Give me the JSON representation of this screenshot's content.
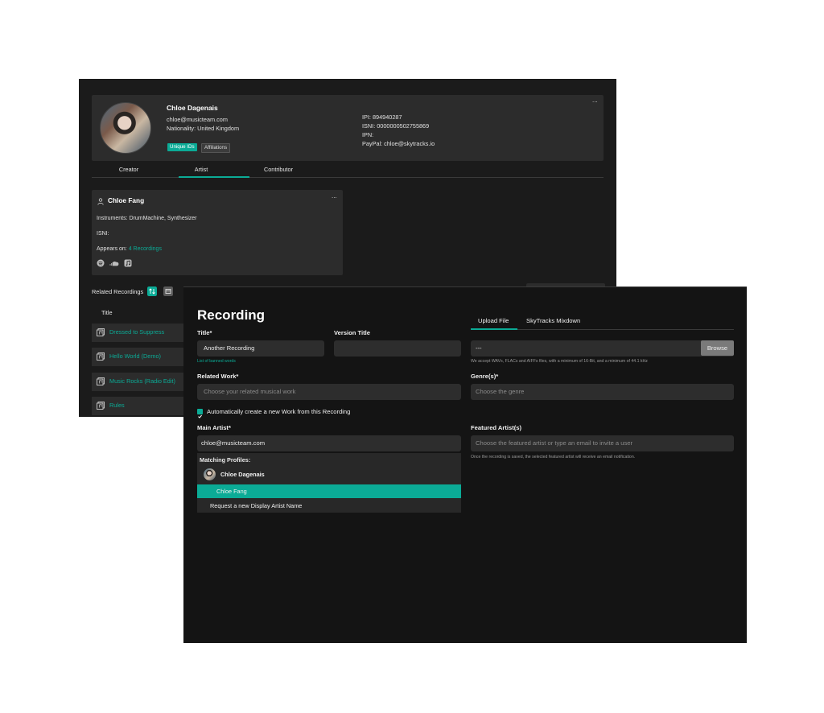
{
  "back": {
    "profile": {
      "name": "Chloe Dagenais",
      "email": "chloe@musicteam.com",
      "nationality": "Nationality: United Kingdom",
      "tags": [
        "Unique IDs",
        "Affiliations"
      ],
      "ipi": "IPI: 894940287",
      "isni": "ISNI: 0000000502755869",
      "ipn": "IPN:",
      "paypal": "PayPal: chloe@skytracks.io",
      "menu": "..."
    },
    "tabs": [
      "Creator",
      "Artist",
      "Contributor"
    ],
    "active_tab": "Artist",
    "artist": {
      "name": "Chloe Fang",
      "instruments": "Instruments: DrumMachine, Synthesizer",
      "isni": "ISNI:",
      "appears_prefix": "Appears on: ",
      "appears_link": "4 Recordings",
      "services": [
        "spotify-icon",
        "soundcloud-icon",
        "apple-music-icon"
      ],
      "menu": "..."
    },
    "related": {
      "label": "Related Recordings",
      "column_title": "Title",
      "rows": [
        "Dressed to Suppress",
        "Hello World (Demo)",
        "Music Rocks (Radio Edit)",
        "Rules"
      ]
    }
  },
  "front": {
    "title": "Recording",
    "fields": {
      "title_label": "Title*",
      "title_value": "Another Recording",
      "banned_link": "List of banned words",
      "version_label": "Version Title",
      "version_value": "",
      "related_work_label": "Related Work*",
      "related_work_placeholder": "Choose your related musical work",
      "auto_create_label": "Automatically create a new Work from this Recording",
      "main_artist_label": "Main Artist*",
      "main_artist_value": "chloe@musicteam.com",
      "genre_label": "Genre(s)*",
      "genre_placeholder": "Choose the genre",
      "featured_label": "Featured Artist(s)",
      "featured_placeholder": "Choose the featured artist or type an email to invite a user",
      "featured_hint": "Once the recording is saved, the selected featured artist will receive an email notification."
    },
    "dropdown": {
      "header": "Matching Profiles:",
      "items": [
        "Chloe Dagenais",
        "Chloe Fang",
        "Request a new Display Artist Name"
      ],
      "selected": "Chloe Fang"
    },
    "upload": {
      "tabs": [
        "Upload File",
        "SkyTracks Mixdown"
      ],
      "active_tab": "Upload File",
      "file_value": "---",
      "browse_label": "Browse",
      "hint": "We accept WAVs, FLACs and AIFFs files, with a minimum of 16-Bit, and a minimum of 44.1 kHz"
    },
    "colors": {
      "accent": "#0bab96",
      "panel": "#2c2c2c",
      "background": "#141414"
    }
  }
}
